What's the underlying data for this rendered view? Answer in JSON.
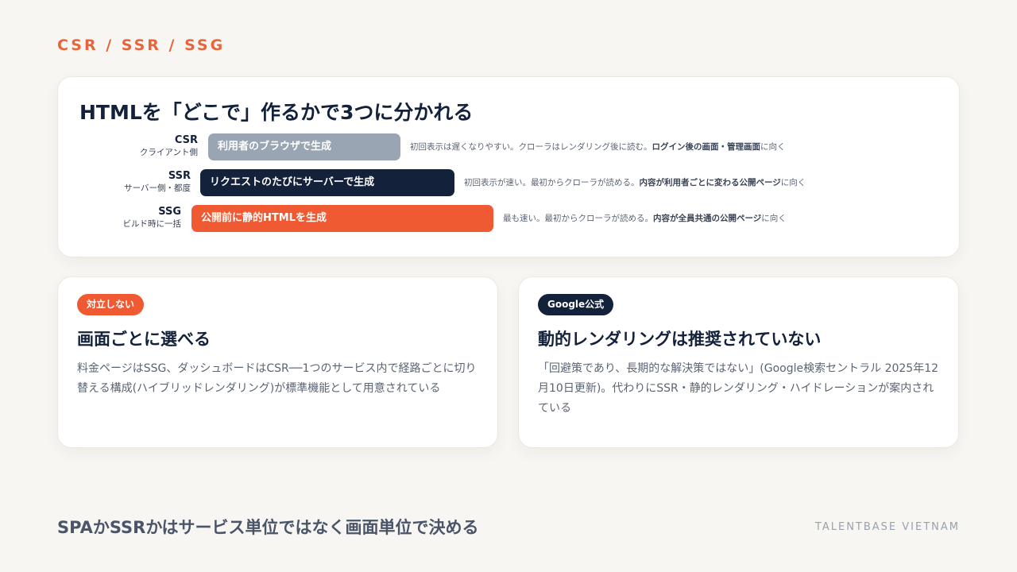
{
  "colors": {
    "accent": "#e8643a",
    "navy": "#13213a",
    "gray_bar": "#9aa5b3",
    "background": "#f8f6f2"
  },
  "eyebrow": "CSR / SSR / SSG",
  "top_card": {
    "title": "HTMLを「どこで」作るかで3つに分かれる",
    "rows": [
      {
        "label": "CSR",
        "sublabel": "クライアント側",
        "bar": "利用者のブラウザで生成",
        "desc_plain": "初回表示は遅くなりやすい。クローラはレンダリング後に読む。",
        "desc_bold": "ログイン後の画面・管理画面",
        "desc_tail": "に向く"
      },
      {
        "label": "SSR",
        "sublabel": "サーバー側・都度",
        "bar": "リクエストのたびにサーバーで生成",
        "desc_plain": "初回表示が速い。最初からクローラが読める。",
        "desc_bold": "内容が利用者ごとに変わる公開ページ",
        "desc_tail": "に向く"
      },
      {
        "label": "SSG",
        "sublabel": "ビルド時に一括",
        "bar": "公開前に静的HTMLを生成",
        "desc_plain": "最も速い。最初からクローラが読める。",
        "desc_bold": "内容が全員共通の公開ページ",
        "desc_tail": "に向く"
      }
    ]
  },
  "card_left": {
    "badge": "対立しない",
    "title": "画面ごとに選べる",
    "body": "料金ページはSSG、ダッシュボードはCSR──1つのサービス内で経路ごとに切り替える構成(ハイブリッドレンダリング)が標準機能として用意されている"
  },
  "card_right": {
    "badge": "Google公式",
    "title": "動的レンダリングは推奨されていない",
    "body": "「回避策であり、長期的な解決策ではない」(Google検索セントラル 2025年12月10日更新)。代わりにSSR・静的レンダリング・ハイドレーションが案内されている"
  },
  "footer": {
    "title": "SPAかSSRかはサービス単位ではなく画面単位で決める",
    "brand": "TALENTBASE VIETNAM"
  }
}
